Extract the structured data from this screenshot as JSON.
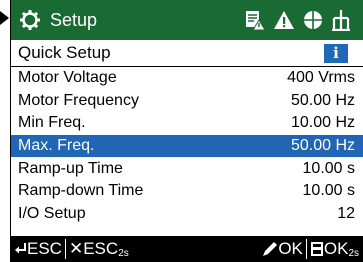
{
  "header": {
    "title": "Setup",
    "icons": [
      "gear-icon",
      "document-alert-icon",
      "warning-icon",
      "globe-icon",
      "fork-icon"
    ]
  },
  "quick_setup": {
    "label": "Quick Setup",
    "info_icon": "i"
  },
  "rows": [
    {
      "label": "Motor Voltage",
      "value": "400 Vrms",
      "selected": false
    },
    {
      "label": "Motor Frequency",
      "value": "50.00 Hz",
      "selected": false
    },
    {
      "label": "Min Freq.",
      "value": "10.00 Hz",
      "selected": false
    },
    {
      "label": "Max. Freq.",
      "value": "50.00 Hz",
      "selected": true
    },
    {
      "label": "Ramp-up Time",
      "value": "10.00 s",
      "selected": false
    },
    {
      "label": "Ramp-down Time",
      "value": "10.00 s",
      "selected": false
    },
    {
      "label": "I/O Setup",
      "value": "12",
      "selected": false
    }
  ],
  "footer": {
    "esc_label": "ESC",
    "esc2_label": "ESC",
    "esc2_sub": "2s",
    "ok_label": "OK",
    "ok2_label": "OK",
    "ok2_sub": "2s"
  },
  "colors": {
    "header": "#1a6a33",
    "selection": "#2165b5",
    "info": "#1f6ab8",
    "footer": "#000000"
  }
}
